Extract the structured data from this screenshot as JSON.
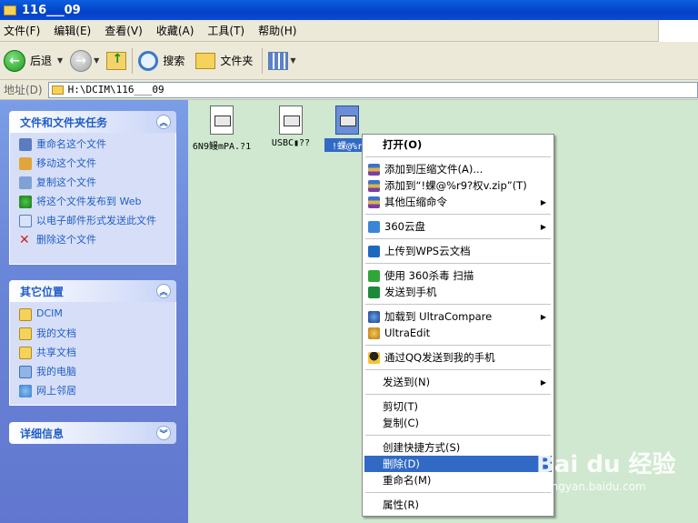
{
  "window": {
    "title": "116___09"
  },
  "menu": [
    "文件(F)",
    "编辑(E)",
    "查看(V)",
    "收藏(A)",
    "工具(T)",
    "帮助(H)"
  ],
  "toolbar": {
    "back": "后退",
    "search": "搜索",
    "folders": "文件夹"
  },
  "address": {
    "label": "地址(D)",
    "path": "H:\\DCIM\\116___09"
  },
  "tasks_panel": {
    "title": "文件和文件夹任务",
    "items": [
      "重命名这个文件",
      "移动这个文件",
      "复制这个文件",
      "将这个文件发布到 Web",
      "以电子邮件形式发送此文件",
      "删除这个文件"
    ]
  },
  "places_panel": {
    "title": "其它位置",
    "items": [
      "DCIM",
      "我的文档",
      "共享文档",
      "我的电脑",
      "网上邻居"
    ]
  },
  "details_panel": {
    "title": "详细信息"
  },
  "files": [
    {
      "name": "6N9鳗mPA.?1"
    },
    {
      "name": "USBC▮??"
    },
    {
      "name": "!蜾@%r"
    }
  ],
  "context_menu": {
    "open": "打开(O)",
    "add_archive": "添加到压缩文件(A)...",
    "add_to_zip": "添加到“!蜾@%r9?权v.zip”(T)",
    "other_compress": "其他压缩命令",
    "cloud_360": "360云盘",
    "wps": "上传到WPS云文档",
    "scan_360": "使用 360杀毒 扫描",
    "send_phone": "发送到手机",
    "ultracompare": "加载到 UltraCompare",
    "ultraedit": "UltraEdit",
    "qq_send": "通过QQ发送到我的手机",
    "send_to": "发送到(N)",
    "cut": "剪切(T)",
    "copy": "复制(C)",
    "shortcut": "创建快捷方式(S)",
    "delete": "删除(D)",
    "rename": "重命名(M)",
    "properties": "属性(R)"
  },
  "watermark": {
    "brand": "Bai du 经验",
    "url": "jingyan.baidu.com"
  }
}
